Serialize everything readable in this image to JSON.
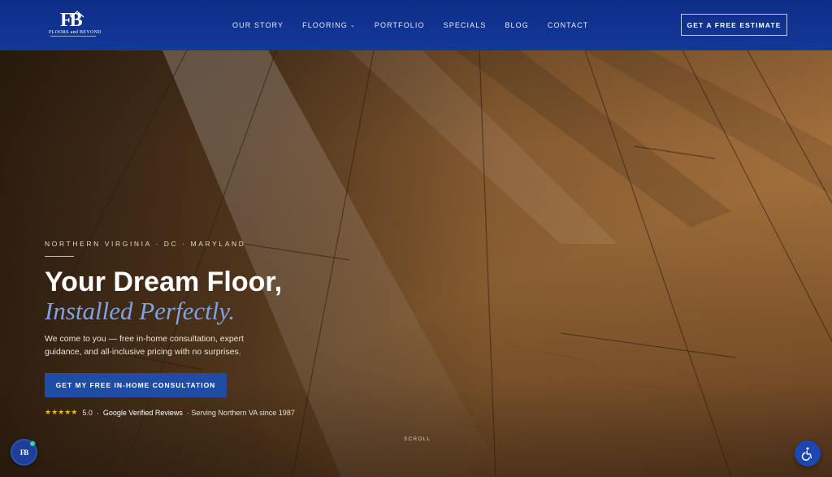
{
  "brand": {
    "logo_mark": "FB",
    "logo_text": "FLOORS and BEYOND"
  },
  "nav": {
    "items": [
      {
        "label": "OUR STORY"
      },
      {
        "label": "FLOORING",
        "has_dropdown": true,
        "chevron": "⌄"
      },
      {
        "label": "PORTFOLIO"
      },
      {
        "label": "SPECIALS"
      },
      {
        "label": "BLOG"
      },
      {
        "label": "CONTACT"
      }
    ],
    "cta_label": "GET A FREE ESTIMATE"
  },
  "hero": {
    "eyebrow": "NORTHERN VIRGINIA · DC · MARYLAND",
    "headline": "Your Dream Floor,",
    "headline_accent": "Installed Perfectly.",
    "subcopy": "We come to you — free in-home consultation, expert guidance, and all-inclusive pricing with no surprises.",
    "cta_label": "GET MY FREE IN-HOME CONSULTATION",
    "reviews": {
      "stars": "★★★★★",
      "rating": "5.0",
      "separator": "·",
      "source": "Google Verified Reviews",
      "tagline": "· Serving Northern VA since 1987"
    },
    "scroll_label": "SCROLL"
  },
  "widgets": {
    "chat_icon": "chat-icon",
    "chat_mark": "FB",
    "accessibility_icon": "accessibility-icon"
  },
  "colors": {
    "header_bg": "#14379a",
    "accent_blue": "#7fa2e3",
    "cta_bg": "#1f4da6",
    "star": "#f2b51e",
    "online": "#3ddc84"
  }
}
